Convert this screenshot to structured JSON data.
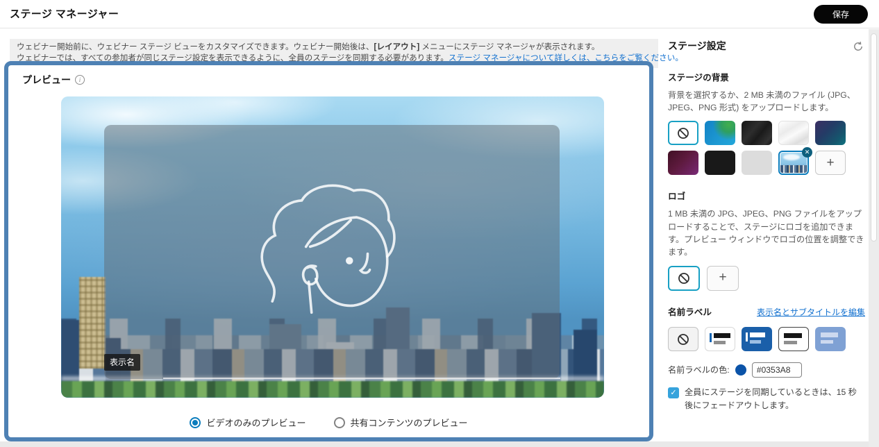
{
  "header": {
    "title": "ステージ マネージャー",
    "save_button": "保存"
  },
  "banner": {
    "line1_before_bold": "ウェビナー開始前に、ウェビナー ステージ ビューをカスタマイズできます。ウェビナー開始後は、",
    "line1_bold": "[レイアウト]",
    "line1_after_bold": " メニューにステージ マネージャが表示されます。",
    "line2_text": "ウェビナーでは、すべての参加者が同じステージ設定を表示できるように、全員のステージを同期する必要があります。",
    "line2_link": "ステージ マネージャについて詳しくは、こちらをご覧ください。"
  },
  "preview": {
    "title": "プレビュー",
    "display_name_label": "表示名",
    "radio_video_only": "ビデオのみのプレビュー",
    "radio_shared_content": "共有コンテンツのプレビュー"
  },
  "sidebar": {
    "title": "ステージ設定",
    "background": {
      "title": "ステージの背景",
      "description": "背景を選択するか、2 MB 未満のファイル (JPG、JPEG、PNG 形式) をアップロードします。",
      "selected_option": "city-photo"
    },
    "logo": {
      "title": "ロゴ",
      "description": "1 MB 未満の JPG、JPEG、PNG ファイルをアップロードすることで、ステージにロゴを追加できます。プレビュー ウィンドウでロゴの位置を調整できます。"
    },
    "name_label": {
      "title": "名前ラベル",
      "edit_link": "表示名とサブタイトルを編集",
      "color_label": "名前ラベルの色:",
      "color_value": "#0353A8",
      "fade_checkbox_label": "全員にステージを同期しているときは、15 秒後にフェードアウトします。",
      "fade_checkbox_checked": true
    }
  },
  "icons": {
    "add_glyph": "+",
    "close_glyph": "✕",
    "check_glyph": "✓",
    "info_glyph": "i"
  },
  "colors": {
    "accent_blue": "#0B7DBD",
    "preview_border": "#4E81B4",
    "link_blue": "#1170CF",
    "name_label_swatch": "#0353A8",
    "save_button_bg": "#060606",
    "teal_selection_border": "#18A0C4"
  }
}
